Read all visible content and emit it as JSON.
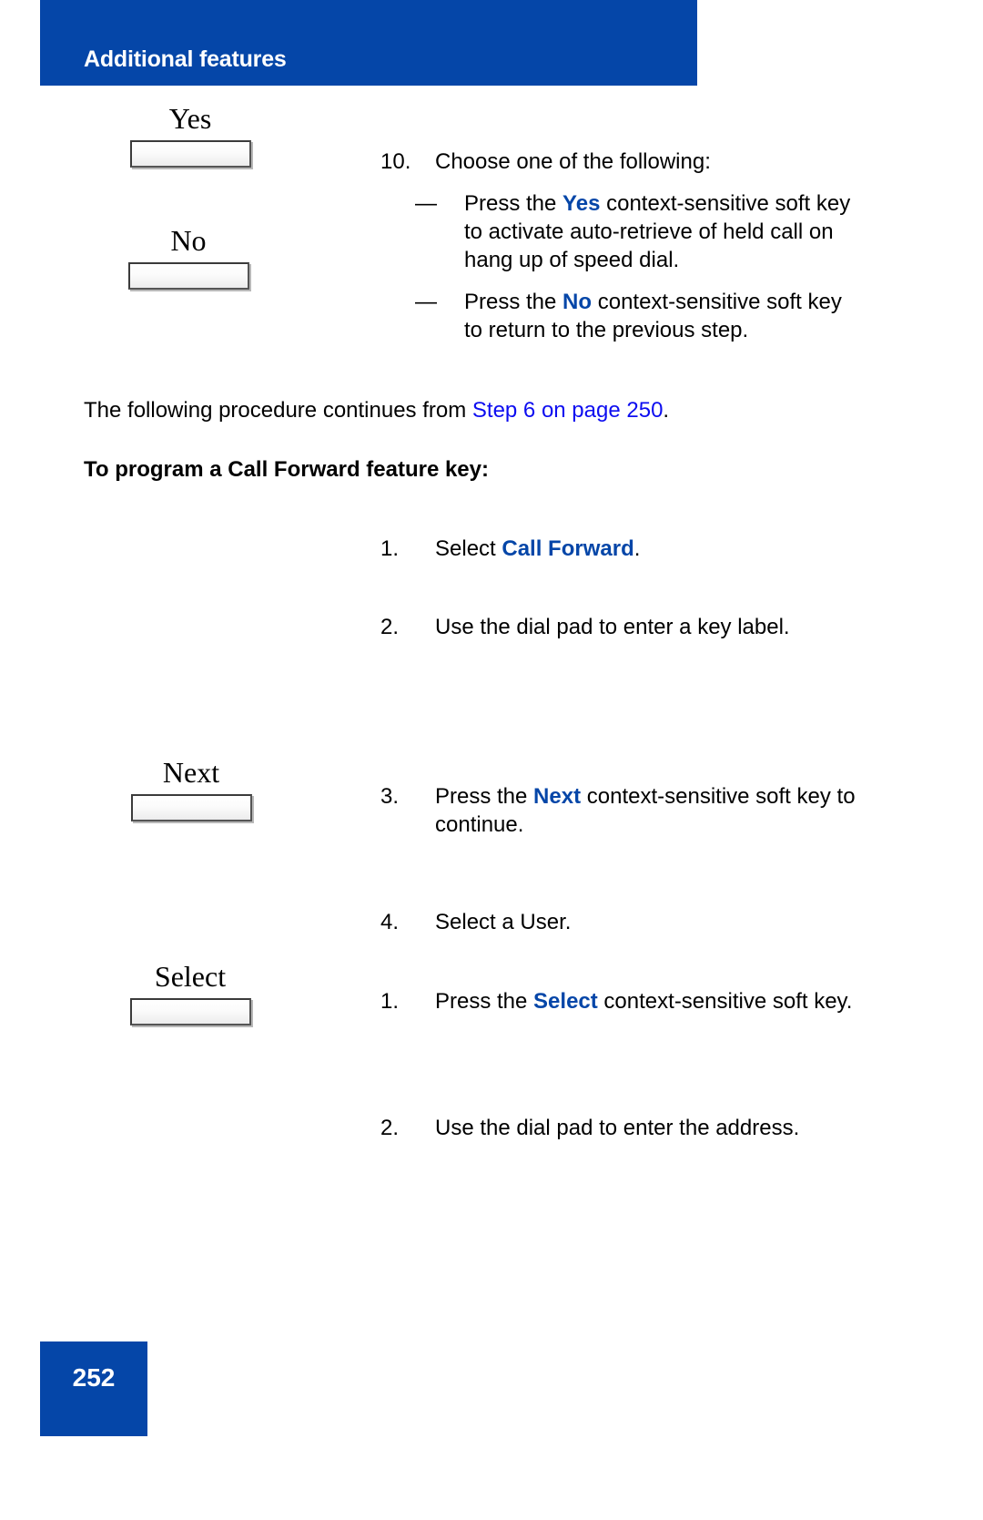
{
  "header": {
    "title": "Additional features",
    "banner_color": "#0546a8"
  },
  "colors": {
    "brand_blue": "#0546a8",
    "link_blue": "#0d0df0",
    "text_black": "#000000"
  },
  "softkeys": [
    {
      "label": "Yes",
      "name": "yes"
    },
    {
      "label": "No",
      "name": "no"
    },
    {
      "label": "Next",
      "name": "next"
    },
    {
      "label": "Select",
      "name": "select"
    }
  ],
  "content": {
    "step10": {
      "number": "10.",
      "text": "Choose one of the following:"
    },
    "bullet_yes": {
      "dash": "—",
      "pre": "Press the ",
      "emphasis": "Yes",
      "post": " context-sensitive soft key to activate auto-retrieve of held call on hang up of speed dial."
    },
    "bullet_no": {
      "dash": "—",
      "pre": "Press the ",
      "emphasis": "No",
      "post": " context-sensitive soft key to return to the previous step."
    },
    "continues": {
      "pre": "The following procedure continues from ",
      "link": "Step 6 on page 250",
      "post": "."
    },
    "section_heading": "To program a Call Forward feature key:",
    "step1_select": {
      "number": "1.",
      "pre": "Select ",
      "emphasis": "Call Forward",
      "post": "."
    },
    "step2_dialpad": {
      "number": "2.",
      "text": "Use the dial pad to enter a key label."
    },
    "step3_next": {
      "number": "3.",
      "pre": "Press the ",
      "emphasis": "Next",
      "post": " context-sensitive soft key to continue."
    },
    "step4_user": {
      "number": "4.",
      "text": "Select a User."
    },
    "substep1_select": {
      "number": "1.",
      "pre": "Press the ",
      "emphasis": "Select",
      "post": " context-sensitive soft key."
    },
    "substep2_address": {
      "number": "2.",
      "text": "Use the dial pad to enter the address."
    }
  },
  "footer": {
    "page_number": "252"
  }
}
